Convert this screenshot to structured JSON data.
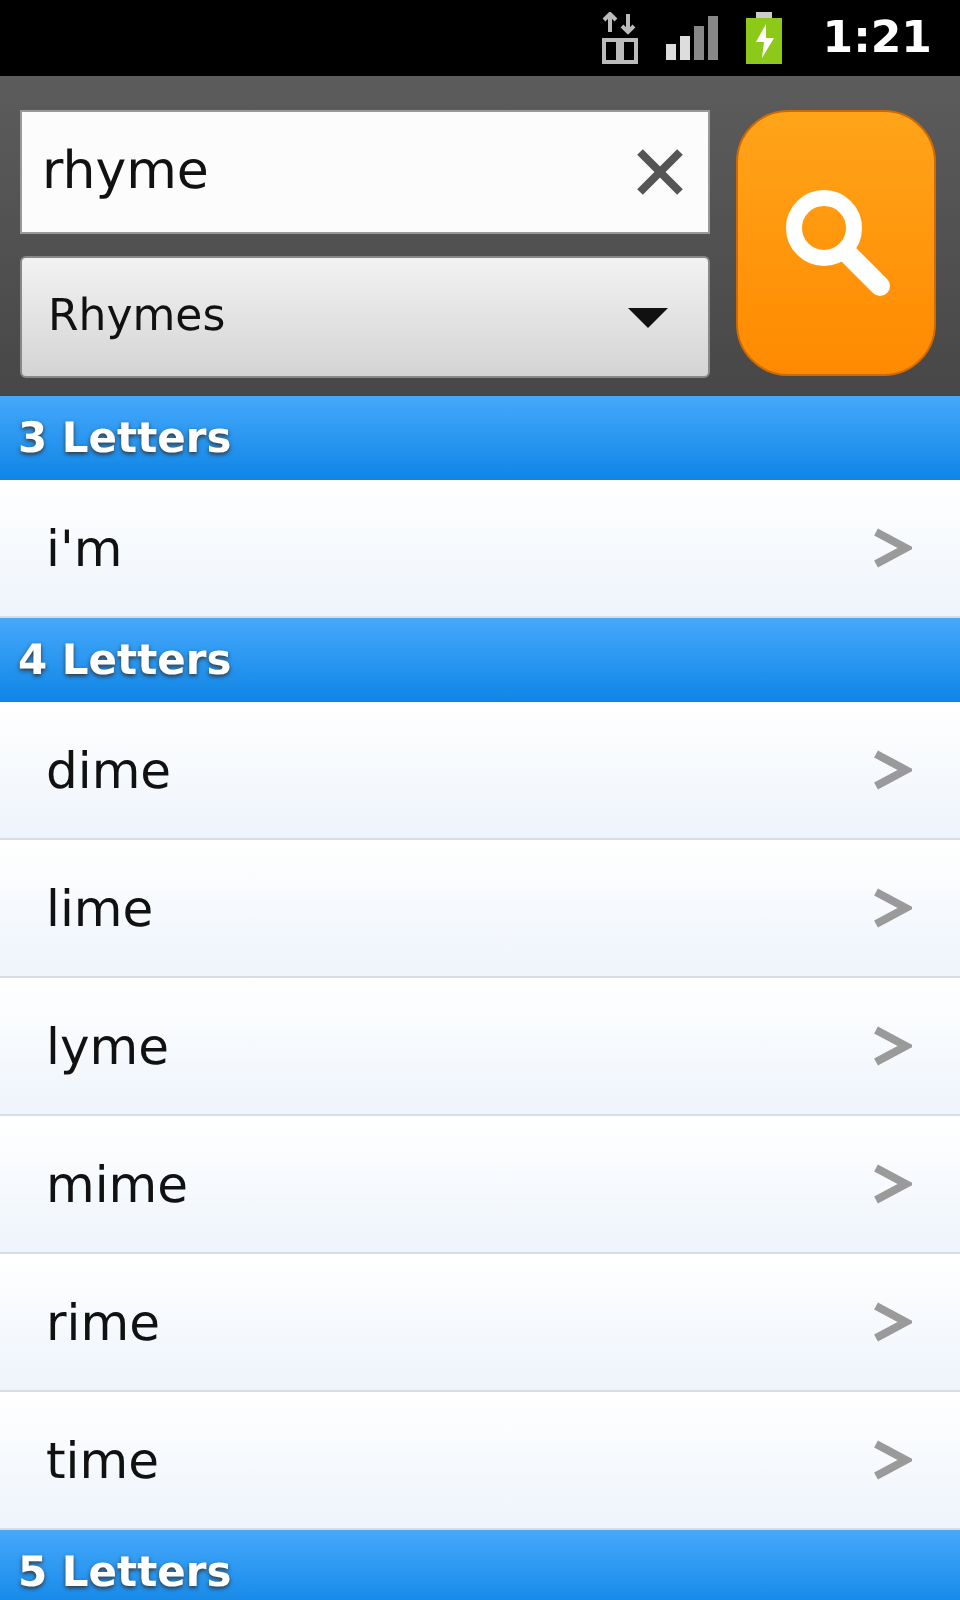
{
  "status_bar": {
    "time": "1:21"
  },
  "search": {
    "value": "rhyme",
    "mode": "Rhymes"
  },
  "sections": [
    {
      "title": "3 Letters",
      "words": [
        "i'm"
      ]
    },
    {
      "title": "4 Letters",
      "words": [
        "dime",
        "lime",
        "lyme",
        "mime",
        "rime",
        "time"
      ]
    },
    {
      "title": "5 Letters"
    }
  ]
}
